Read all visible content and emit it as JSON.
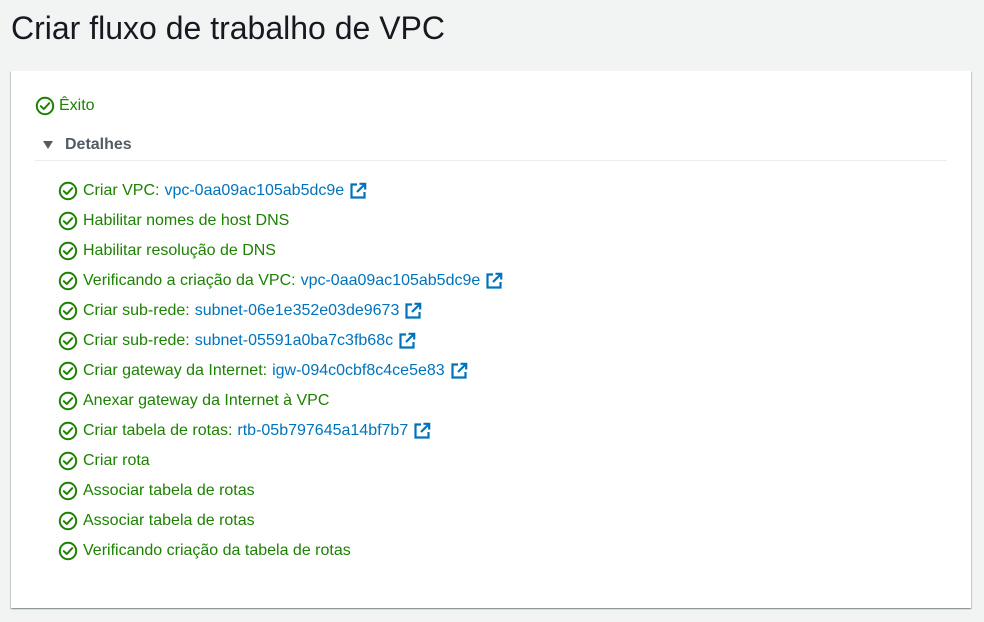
{
  "page": {
    "title": "Criar fluxo de trabalho de VPC"
  },
  "status": {
    "label": "Êxito"
  },
  "details": {
    "label": "Detalhes"
  },
  "steps": [
    {
      "label": "Criar VPC:",
      "link": "vpc-0aa09ac105ab5dc9e"
    },
    {
      "label": "Habilitar nomes de host DNS"
    },
    {
      "label": "Habilitar resolução de DNS"
    },
    {
      "label": "Verificando a criação da VPC:",
      "link": "vpc-0aa09ac105ab5dc9e"
    },
    {
      "label": "Criar sub-rede:",
      "link": "subnet-06e1e352e03de9673"
    },
    {
      "label": "Criar sub-rede:",
      "link": "subnet-05591a0ba7c3fb68c"
    },
    {
      "label": "Criar gateway da Internet:",
      "link": "igw-094c0cbf8c4ce5e83"
    },
    {
      "label": "Anexar gateway da Internet à VPC"
    },
    {
      "label": "Criar tabela de rotas:",
      "link": "rtb-05b797645a14bf7b7"
    },
    {
      "label": "Criar rota"
    },
    {
      "label": "Associar tabela de rotas"
    },
    {
      "label": "Associar tabela de rotas"
    },
    {
      "label": "Verificando criação da tabela de rotas"
    }
  ],
  "icons": {
    "success": "check-circle-icon",
    "external": "external-link-icon",
    "caret": "caret-down-icon"
  },
  "colors": {
    "success": "#1d8102",
    "link": "#0073bb",
    "title": "#16191f",
    "muted": "#545b64"
  }
}
